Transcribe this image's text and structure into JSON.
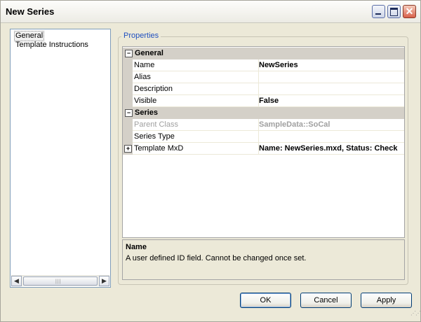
{
  "window": {
    "title": "New Series"
  },
  "nav": {
    "items": [
      {
        "label": "General"
      },
      {
        "label": "Template Instructions"
      }
    ]
  },
  "properties": {
    "group_label": "Properties",
    "categories": [
      {
        "label": "General",
        "rows": [
          {
            "name": "Name",
            "value": "NewSeries"
          },
          {
            "name": "Alias",
            "value": ""
          },
          {
            "name": "Description",
            "value": ""
          },
          {
            "name": "Visible",
            "value": "False"
          }
        ]
      },
      {
        "label": "Series",
        "rows": [
          {
            "name": "Parent Class",
            "value": "SampleData::SoCal",
            "disabled": true
          },
          {
            "name": "Series Type",
            "value": ""
          },
          {
            "name": "Template MxD",
            "value": "Name: NewSeries.mxd, Status: Check"
          }
        ]
      }
    ],
    "help": {
      "title": "Name",
      "description": "A user defined ID field. Cannot be changed once set."
    }
  },
  "buttons": {
    "ok": "OK",
    "cancel": "Cancel",
    "apply": "Apply"
  },
  "icons": {
    "collapse": "⊟",
    "expand": "⊞",
    "close": "✕"
  }
}
